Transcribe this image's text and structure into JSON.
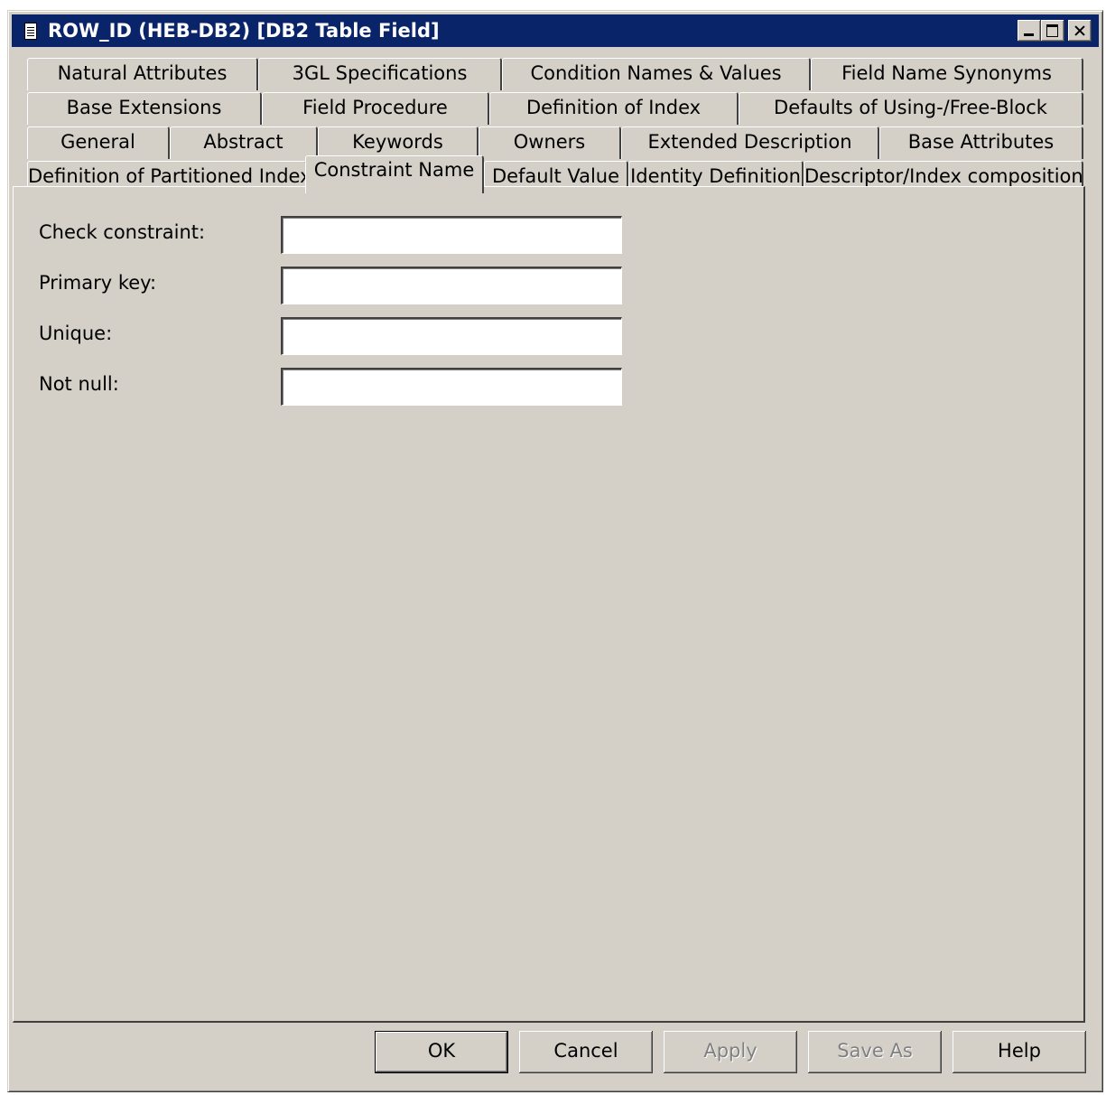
{
  "window": {
    "title": "ROW_ID (HEB-DB2) [DB2 Table Field]"
  },
  "tabs": {
    "row1": [
      "Natural Attributes",
      "3GL Specifications",
      "Condition Names & Values",
      "Field Name Synonyms"
    ],
    "row2": [
      "Base Extensions",
      "Field Procedure",
      "Definition of Index",
      "Defaults of Using-/Free-Block"
    ],
    "row3": [
      "General",
      "Abstract",
      "Keywords",
      "Owners",
      "Extended Description",
      "Base Attributes"
    ],
    "row4": [
      "Definition of Partitioned Index",
      "Constraint Name",
      "Default Value",
      "Identity Definition",
      "Descriptor/Index composition"
    ],
    "active": "Constraint Name"
  },
  "form": {
    "check_constraint_label": "Check constraint:",
    "check_constraint_value": "",
    "primary_key_label": "Primary key:",
    "primary_key_value": "",
    "unique_label": "Unique:",
    "unique_value": "",
    "not_null_label": "Not null:",
    "not_null_value": ""
  },
  "buttons": {
    "ok": "OK",
    "cancel": "Cancel",
    "apply": "Apply",
    "save_as": "Save As",
    "help": "Help"
  }
}
